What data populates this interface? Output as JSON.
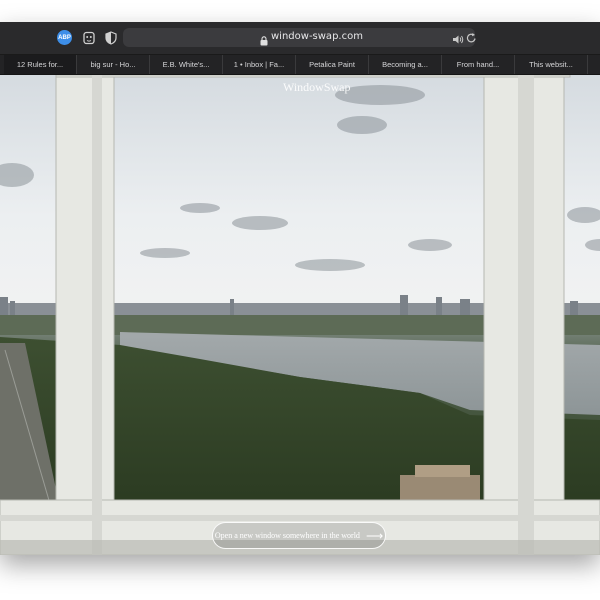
{
  "browser": {
    "url": "window-swap.com",
    "toolbar_icons": [
      "abp-icon",
      "ghost-icon",
      "shield-icon",
      "lock-icon",
      "speaker-icon",
      "reload-icon"
    ],
    "abp_label": "ABP"
  },
  "tabs": [
    {
      "label": "12 Rules for..."
    },
    {
      "label": "big sur - Ho..."
    },
    {
      "label": "E.B. White's..."
    },
    {
      "label": "1 • Inbox | Fa..."
    },
    {
      "label": "Petalica Paint"
    },
    {
      "label": "Becoming a..."
    },
    {
      "label": "From hand..."
    },
    {
      "label": "This websit..."
    }
  ],
  "page": {
    "logo": "WindowSwap",
    "cta_label": "Open a new window somewhere in the world",
    "cta_arrow": "⟶"
  },
  "colors": {
    "toolbar": "#2a2a2c",
    "tabbar": "#232325",
    "frame": "#e9eae6",
    "abp": "#3d8ee8"
  }
}
